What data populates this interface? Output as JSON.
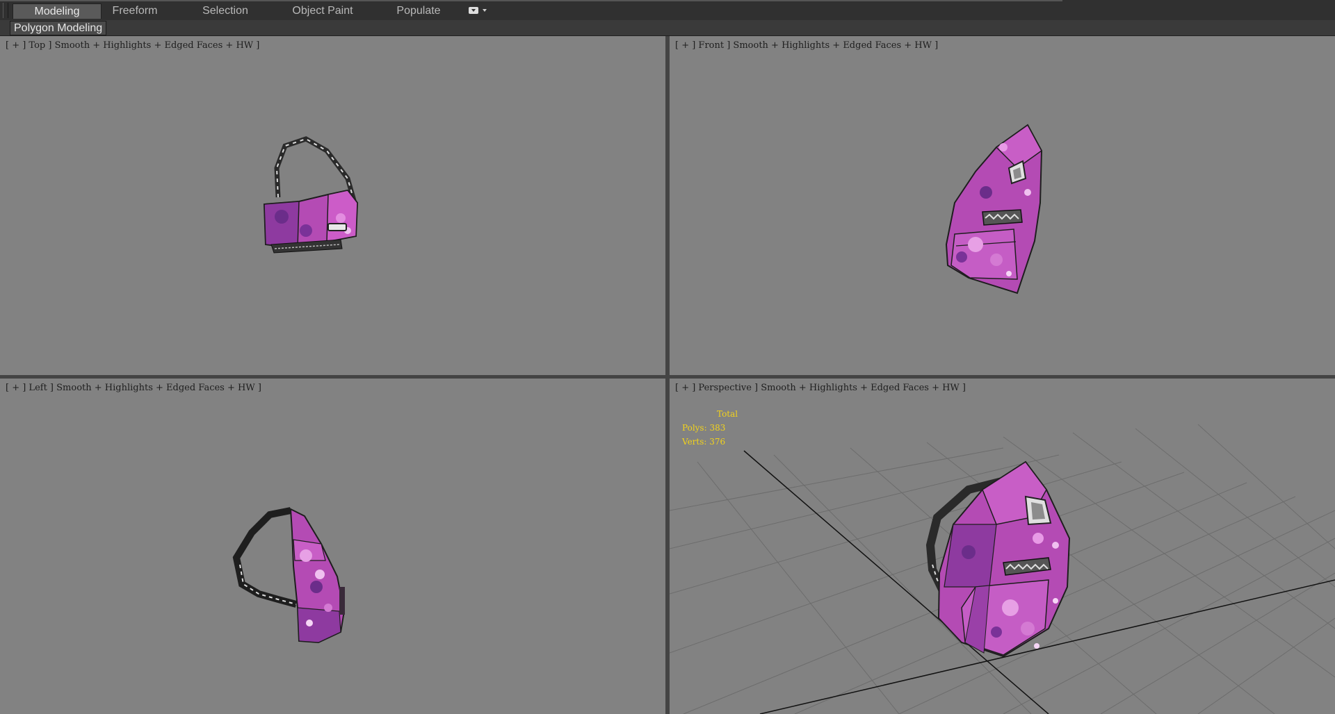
{
  "ribbon": {
    "tabs": [
      {
        "label": "Modeling",
        "active": true
      },
      {
        "label": "Freeform",
        "active": false
      },
      {
        "label": "Selection",
        "active": false
      },
      {
        "label": "Object Paint",
        "active": false
      },
      {
        "label": "Populate",
        "active": false
      }
    ],
    "panel_button": "Polygon Modeling"
  },
  "viewports": {
    "top": {
      "label": "[ + ] Top ] Smooth + Highlights + Edged Faces + HW ]"
    },
    "front": {
      "label": "[ + ] Front ] Smooth + Highlights + Edged Faces + HW ]"
    },
    "left": {
      "label": "[ + ] Left ] Smooth + Highlights + Edged Faces + HW ]"
    },
    "perspective": {
      "label": "[ + ] Perspective ] Smooth + Highlights + Edged Faces + HW ]",
      "stats": {
        "total_label": "Total",
        "polys": "Polys: 383",
        "verts": "Verts: 376"
      }
    }
  },
  "colors": {
    "viewport_bg": "#828282",
    "bag_pink": "#c04cbc",
    "bag_dark": "#7a2d92",
    "strap": "#2a2a2a",
    "stats_text": "#f2d21c"
  },
  "icons": [
    "dropdown-icon",
    "caret-down-icon"
  ]
}
